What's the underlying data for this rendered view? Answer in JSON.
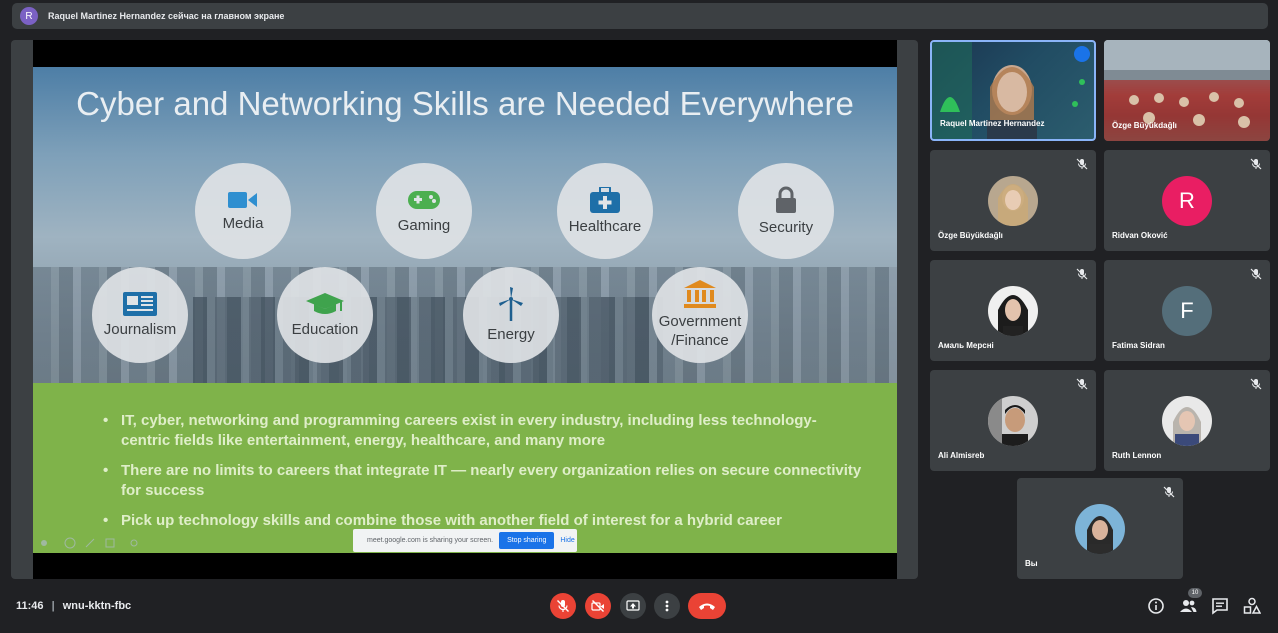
{
  "banner": {
    "avatar_letter": "R",
    "text": "Raquel Martinez Hernandez сейчас на главном экране"
  },
  "slide": {
    "title": "Cyber and Networking Skills are Needed Everywhere",
    "topics": [
      "Media",
      "Gaming",
      "Healthcare",
      "Security",
      "Journalism",
      "Education",
      "Energy",
      "Government\n/Finance"
    ],
    "bullets": [
      "IT, cyber, networking and programming careers exist in every industry, including less technology-centric fields like entertainment, energy, healthcare, and many more",
      "There are no limits to careers that integrate IT — nearly every organization relies on secure connectivity for success",
      "Pick up technology skills and combine those with another field of interest for a hybrid career"
    ]
  },
  "sharebar": {
    "message": "meet.google.com is sharing your screen.",
    "stop_label": "Stop sharing",
    "hide_label": "Hide"
  },
  "participants": [
    {
      "name": "Raquel Martinez Hernandez"
    },
    {
      "name": "Özge Büyükdağlı"
    },
    {
      "name": "Özge Büyükdağlı"
    },
    {
      "name": "Ridvan Oković",
      "initial": "R",
      "color": "#e91e63"
    },
    {
      "name": "Амаль Мерсні"
    },
    {
      "name": "Fatima Sidran",
      "initial": "F",
      "color": "#546e7a"
    },
    {
      "name": "Ali Almisreb"
    },
    {
      "name": "Ruth Lennon"
    },
    {
      "name": "Вы"
    }
  ],
  "toolbar": {
    "time": "11:46",
    "separator": "|",
    "meeting_code": "wnu-kktn-fbc",
    "participant_count": "10"
  },
  "colors": {
    "accent_red": "#ea4335",
    "accent_blue": "#1a73e8",
    "background": "#202124",
    "tile": "#3c4043"
  }
}
